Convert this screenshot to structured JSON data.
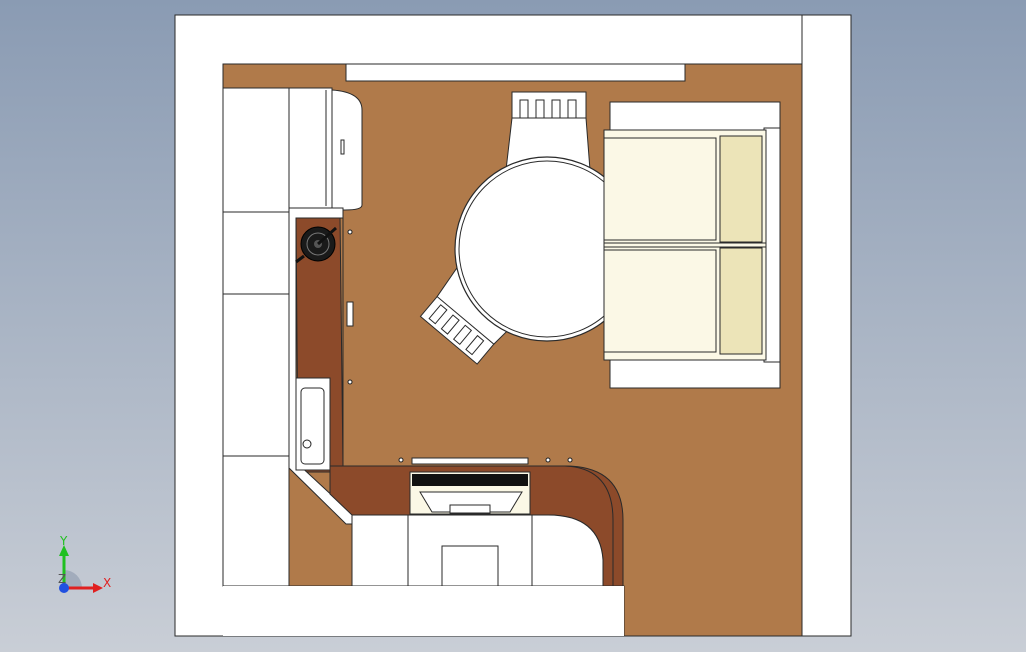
{
  "colors": {
    "bg_top": "#8a9bb3",
    "bg_bottom": "#c9ced6",
    "wall": "#ffffff",
    "floor": "#b07a4a",
    "counter": "#8c4a2a",
    "outline": "#2a2a2a",
    "cream": "#fbf8e6",
    "cream_shade": "#ece4b8",
    "axis_x": "#e02020",
    "axis_y": "#20c020",
    "axis_z": "#2050e0"
  },
  "icons": {
    "triad": "xyz-triad-icon"
  },
  "triad": {
    "x_label": "X",
    "y_label": "Y",
    "z_label": "Z"
  }
}
